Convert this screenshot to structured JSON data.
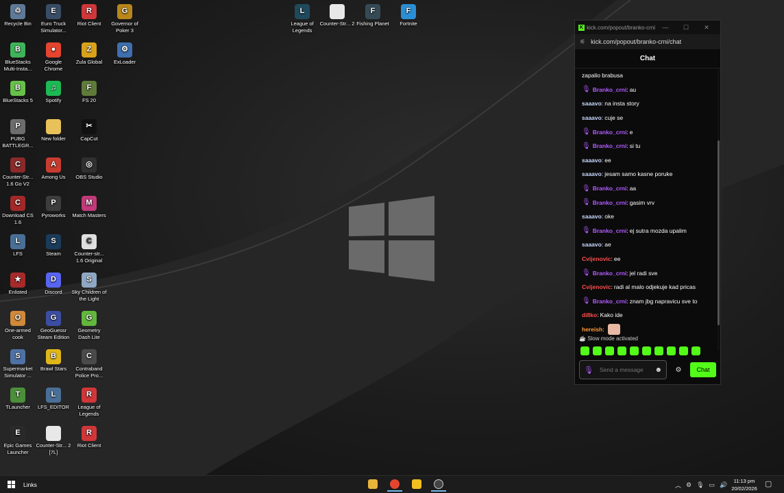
{
  "desktop": {
    "icons": [
      {
        "label": "Recycle Bin",
        "icon": "recycle-bin-icon",
        "color": "#5f7a99",
        "glyph": "♲"
      },
      {
        "label": "Euro Truck Simulator...",
        "icon": "truck-game-icon",
        "color": "#3a4d66",
        "glyph": "E"
      },
      {
        "label": "Riot Client",
        "icon": "riot-client-icon",
        "color": "#d13639",
        "glyph": "R"
      },
      {
        "label": "Governor of Poker 3",
        "icon": "poker-game-icon",
        "color": "#b8861b",
        "glyph": "G"
      },
      {
        "label": "League of Legends",
        "icon": "league-icon",
        "color": "#1f4a5c",
        "glyph": "L"
      },
      {
        "label": "Counter-Str... 2",
        "icon": "file-icon",
        "color": "#e8e8e8",
        "glyph": ""
      },
      {
        "label": "Fishing Planet",
        "icon": "fishing-game-icon",
        "color": "#344b55",
        "glyph": "F"
      },
      {
        "label": "Fortnite",
        "icon": "fortnite-icon",
        "color": "#2b8fd6",
        "glyph": "F"
      },
      {
        "label": "BlueStacks Multi-Insta...",
        "icon": "bluestacks-icon",
        "color": "#3fb35a",
        "glyph": "B"
      },
      {
        "label": "Google Chrome",
        "icon": "chrome-icon",
        "color": "#e5452e",
        "glyph": "●"
      },
      {
        "label": "Zula Global",
        "icon": "zula-icon",
        "color": "#d9a21b",
        "glyph": "Z"
      },
      {
        "label": "ExLoader",
        "icon": "exloader-icon",
        "color": "#3e6fae",
        "glyph": "⚙"
      },
      {
        "label": "BlueStacks 5",
        "icon": "bluestacks5-icon",
        "color": "#67c14a",
        "glyph": "B"
      },
      {
        "label": "Spotify",
        "icon": "spotify-icon",
        "color": "#1db954",
        "glyph": "♫"
      },
      {
        "label": "FS 20",
        "icon": "farming-icon",
        "color": "#5f7b3a",
        "glyph": "F"
      },
      {
        "label": "PUBG BATTLEGR...",
        "icon": "pubg-icon",
        "color": "#6d6d6d",
        "glyph": "P"
      },
      {
        "label": "New folder",
        "icon": "folder-icon",
        "color": "#e8c15a",
        "glyph": ""
      },
      {
        "label": "CapCut",
        "icon": "capcut-icon",
        "color": "#111111",
        "glyph": "✂"
      },
      {
        "label": "Counter-Str... 1.6 Go V2",
        "icon": "cs-icon",
        "color": "#8b2a2a",
        "glyph": "C"
      },
      {
        "label": "Among Us",
        "icon": "among-us-icon",
        "color": "#c83b2f",
        "glyph": "A"
      },
      {
        "label": "OBS Studio",
        "icon": "obs-icon",
        "color": "#303030",
        "glyph": "◎"
      },
      {
        "label": "Download CS 1.6",
        "icon": "cs-download-icon",
        "color": "#a42828",
        "glyph": "C"
      },
      {
        "label": "Pyroworks",
        "icon": "pyroworks-icon",
        "color": "#3d3d3d",
        "glyph": "P"
      },
      {
        "label": "Match Masters",
        "icon": "match-masters-icon",
        "color": "#c23a7a",
        "glyph": "M"
      },
      {
        "label": "LFS",
        "icon": "lfs-icon",
        "color": "#4a6f96",
        "glyph": "L"
      },
      {
        "label": "Steam",
        "icon": "steam-icon",
        "color": "#1b3b5a",
        "glyph": "S"
      },
      {
        "label": "Counter-str... 1.6 Original",
        "icon": "cs-original-icon",
        "color": "#e0e0e0",
        "glyph": "C"
      },
      {
        "label": "Enlisted",
        "icon": "enlisted-icon",
        "color": "#a62a2a",
        "glyph": "★"
      },
      {
        "label": "Discord",
        "icon": "discord-icon",
        "color": "#5865f2",
        "glyph": "D"
      },
      {
        "label": "Sky Children of the Light",
        "icon": "sky-icon",
        "color": "#8fa9c4",
        "glyph": "S"
      },
      {
        "label": "One-armed cook",
        "icon": "cook-game-icon",
        "color": "#d18a3a",
        "glyph": "O"
      },
      {
        "label": "GeoGuessr Steam Edition",
        "icon": "geoguessr-icon",
        "color": "#3b4ea3",
        "glyph": "G"
      },
      {
        "label": "Geometry Dash Lite",
        "icon": "geometry-dash-icon",
        "color": "#62b83d",
        "glyph": "G"
      },
      {
        "label": "Supermarket Simulator ...",
        "icon": "supermarket-icon",
        "color": "#4f72a6",
        "glyph": "S"
      },
      {
        "label": "Brawl Stars",
        "icon": "brawl-stars-icon",
        "color": "#e0b71a",
        "glyph": "B"
      },
      {
        "label": "Contraband Police Pro...",
        "icon": "contraband-icon",
        "color": "#4a4a4a",
        "glyph": "C"
      },
      {
        "label": "TLauncher",
        "icon": "tlauncher-icon",
        "color": "#4c8f3a",
        "glyph": "T"
      },
      {
        "label": "LFS_EDITOR",
        "icon": "lfs-editor-icon",
        "color": "#4a6f96",
        "glyph": "L"
      },
      {
        "label": "League of Legends",
        "icon": "league-riot-icon",
        "color": "#d13639",
        "glyph": "R"
      },
      {
        "label": "Epic Games Launcher",
        "icon": "epic-games-icon",
        "color": "#2a2a2a",
        "glyph": "E"
      },
      {
        "label": "Counter-Str... 2 [7L]",
        "icon": "file-icon",
        "color": "#e8e8e8",
        "glyph": ""
      },
      {
        "label": "Riot Client",
        "icon": "riot-client-icon",
        "color": "#d13639",
        "glyph": "R"
      }
    ]
  },
  "chat_window": {
    "title": "kick.com/popout/branko-crni/chat",
    "url": "kick.com/popout/branko-crni/chat",
    "header": "Chat",
    "messages": [
      {
        "user": "",
        "text": "zapalio brabusa",
        "color": "#ffffff",
        "badge": false
      },
      {
        "user": "Branko_crni",
        "text": "au",
        "color": "#b35cff",
        "badge": true
      },
      {
        "user": "saaavo",
        "text": "na insta story",
        "color": "#c9d9ff",
        "badge": false
      },
      {
        "user": "saaavo",
        "text": "cuje se",
        "color": "#c9d9ff",
        "badge": false
      },
      {
        "user": "Branko_crni",
        "text": "e",
        "color": "#b35cff",
        "badge": true
      },
      {
        "user": "Branko_crni",
        "text": "si tu",
        "color": "#b35cff",
        "badge": true
      },
      {
        "user": "saaavo",
        "text": "ee",
        "color": "#c9d9ff",
        "badge": false
      },
      {
        "user": "saaavo",
        "text": "jesam samo kasne poruke",
        "color": "#c9d9ff",
        "badge": false
      },
      {
        "user": "Branko_crni",
        "text": "aa",
        "color": "#b35cff",
        "badge": true
      },
      {
        "user": "Branko_crni",
        "text": "gasim vrv",
        "color": "#b35cff",
        "badge": true
      },
      {
        "user": "saaavo",
        "text": "oke",
        "color": "#c9d9ff",
        "badge": false
      },
      {
        "user": "Branko_crni",
        "text": "ej sutra mozda upalim",
        "color": "#b35cff",
        "badge": true
      },
      {
        "user": "saaavo",
        "text": "ae",
        "color": "#c9d9ff",
        "badge": false
      },
      {
        "user": "Cvijenovic",
        "text": "ee",
        "color": "#ff4d4d",
        "badge": false
      },
      {
        "user": "Branko_crni",
        "text": "jel radi sve",
        "color": "#b35cff",
        "badge": true
      },
      {
        "user": "Cvijenovic",
        "text": "radi al malo odjekuje kad pricas",
        "color": "#ff4d4d",
        "badge": false
      },
      {
        "user": "Branko_crni",
        "text": "znam jbg napravicu sve to",
        "color": "#b35cff",
        "badge": true
      },
      {
        "user": "di8ko",
        "text": "Kako ide",
        "color": "#ff4d4d",
        "badge": false
      },
      {
        "user": "hereish",
        "text": "",
        "color": "#ff9a3c",
        "badge": false,
        "emote": true
      }
    ],
    "slow_mode": "Slow mode activated",
    "input_placeholder": "Send a message",
    "send_label": "Chat",
    "accent": "#53fc18"
  },
  "taskbar": {
    "links_label": "Links",
    "time": "11:13 pm",
    "date": "20/02/2026",
    "pinned": [
      "file-explorer-icon",
      "chrome-icon",
      "kick-icon",
      "obs-icon"
    ]
  }
}
